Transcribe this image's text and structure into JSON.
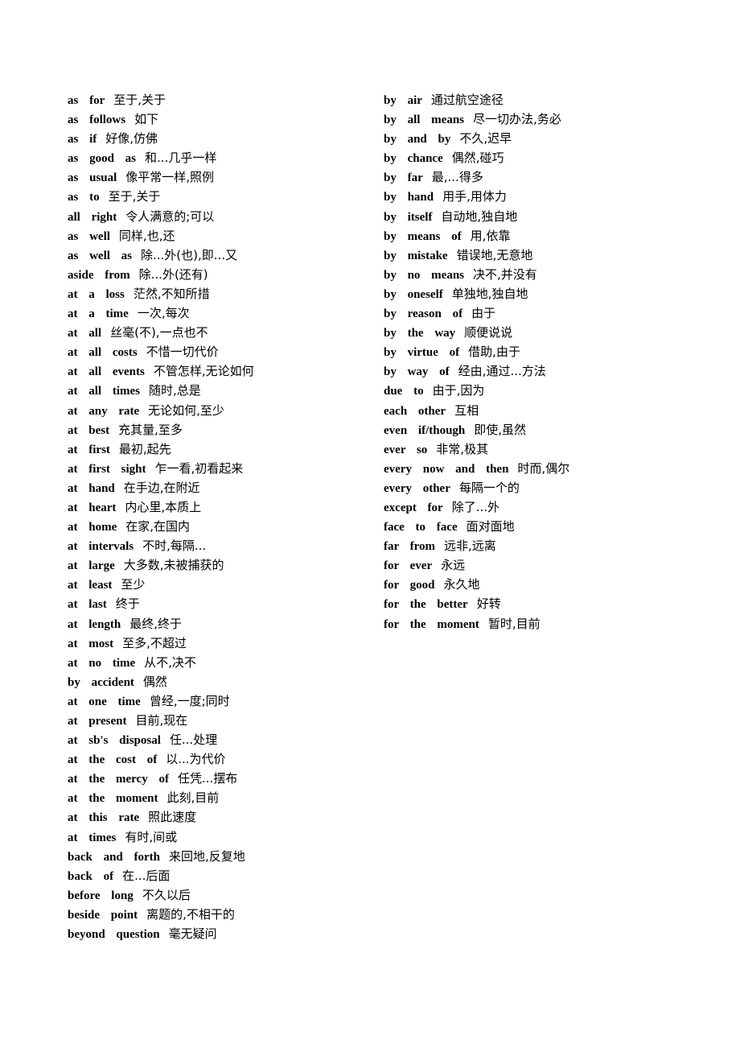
{
  "document": {
    "columns": [
      {
        "entries": [
          {
            "en": "as  for",
            "zh": "至于,关于"
          },
          {
            "en": "as  follows",
            "zh": "如下"
          },
          {
            "en": "as  if",
            "zh": "好像,仿佛"
          },
          {
            "en": "as  good  as",
            "zh": "和...几乎一样"
          },
          {
            "en": "as  usual",
            "zh": "像平常一样,照例"
          },
          {
            "en": "as  to",
            "zh": "至于,关于"
          },
          {
            "en": "all  right",
            "zh": "令人满意的;可以"
          },
          {
            "en": "as  well",
            "zh": "同样,也,还"
          },
          {
            "en": "as  well  as",
            "zh": "除...外(也),即...又"
          },
          {
            "en": "aside  from",
            "zh": "除...外(还有)"
          },
          {
            "en": "at  a  loss",
            "zh": "茫然,不知所措"
          },
          {
            "en": "at  a  time",
            "zh": "一次,每次"
          },
          {
            "en": "at  all",
            "zh": "丝毫(不),一点也不"
          },
          {
            "en": "at  all  costs",
            "zh": "不惜一切代价"
          },
          {
            "en": "at  all  events",
            "zh": "不管怎样,无论如何"
          },
          {
            "en": "at  all  times",
            "zh": "随时,总是"
          },
          {
            "en": "at  any  rate",
            "zh": "无论如何,至少"
          },
          {
            "en": "at  best",
            "zh": "充其量,至多"
          },
          {
            "en": "at  first",
            "zh": "最初,起先"
          },
          {
            "en": "at  first  sight",
            "zh": "乍一看,初看起来"
          },
          {
            "en": "at  hand",
            "zh": "在手边,在附近"
          },
          {
            "en": "at  heart",
            "zh": "内心里,本质上"
          },
          {
            "en": "at  home",
            "zh": "在家,在国内"
          },
          {
            "en": "at  intervals",
            "zh": "不时,每隔..."
          },
          {
            "en": "at  large",
            "zh": "大多数,未被捕获的"
          },
          {
            "en": "at  least",
            "zh": "至少"
          },
          {
            "en": "at  last",
            "zh": "终于"
          },
          {
            "en": "at  length",
            "zh": "最终,终于"
          },
          {
            "en": "at  most",
            "zh": "至多,不超过"
          },
          {
            "en": "at  no  time",
            "zh": "从不,决不"
          },
          {
            "en": "by  accident",
            "zh": "偶然"
          },
          {
            "en": "at  one  time",
            "zh": "曾经,一度;同时"
          },
          {
            "en": "at  present",
            "zh": "目前,现在"
          },
          {
            "en": "at  sb's  disposal",
            "zh": "任...处理"
          },
          {
            "en": "at  the  cost  of",
            "zh": "以...为代价"
          },
          {
            "en": "at  the  mercy  of",
            "zh": "任凭...摆布"
          },
          {
            "en": "at  the  moment",
            "zh": "此刻,目前"
          },
          {
            "en": "at  this  rate",
            "zh": "照此速度"
          },
          {
            "en": "at  times",
            "zh": "有时,间或"
          },
          {
            "en": "back  and  forth",
            "zh": "来回地,反复地"
          },
          {
            "en": "back  of",
            "zh": "在...后面"
          },
          {
            "en": "before  long",
            "zh": "不久以后"
          },
          {
            "en": "beside  point",
            "zh": "离题的,不相干的"
          },
          {
            "en": "beyond  question",
            "zh": "毫无疑问"
          }
        ]
      },
      {
        "entries": [
          {
            "en": "by  air",
            "zh": "通过航空途径"
          },
          {
            "en": "by  all  means",
            "zh": "尽一切办法,务必"
          },
          {
            "en": "by  and  by",
            "zh": "不久,迟早"
          },
          {
            "en": "by  chance",
            "zh": "偶然,碰巧"
          },
          {
            "en": "by  far",
            "zh": "最,...得多"
          },
          {
            "en": "by  hand",
            "zh": "用手,用体力"
          },
          {
            "en": "by  itself",
            "zh": "自动地,独自地"
          },
          {
            "en": "by  means  of",
            "zh": "用,依靠"
          },
          {
            "en": "by  mistake",
            "zh": "错误地,无意地"
          },
          {
            "en": "by  no  means",
            "zh": "决不,并没有"
          },
          {
            "en": "by  oneself",
            "zh": "单独地,独自地"
          },
          {
            "en": "by  reason  of",
            "zh": "由于"
          },
          {
            "en": "by  the  way",
            "zh": "顺便说说"
          },
          {
            "en": "by  virtue  of",
            "zh": "借助,由于"
          },
          {
            "en": "by  way  of",
            "zh": "经由,通过...方法"
          },
          {
            "en": "due  to",
            "zh": "由于,因为"
          },
          {
            "en": "each  other",
            "zh": "互相"
          },
          {
            "en": "even  if/though",
            "zh": "即使,虽然"
          },
          {
            "en": "ever  so",
            "zh": "非常,极其"
          },
          {
            "en": "every  now  and  then",
            "zh": "时而,偶尔"
          },
          {
            "en": "every  other",
            "zh": "每隔一个的"
          },
          {
            "en": "except  for",
            "zh": "除了...外"
          },
          {
            "en": "face  to  face",
            "zh": "面对面地"
          },
          {
            "en": "far  from",
            "zh": "远非,远离"
          },
          {
            "en": "for  ever",
            "zh": "永远"
          },
          {
            "en": "for  good",
            "zh": "永久地"
          },
          {
            "en": "for  the  better",
            "zh": "好转"
          },
          {
            "en": "for  the  moment",
            "zh": "暂时,目前"
          }
        ]
      }
    ]
  }
}
